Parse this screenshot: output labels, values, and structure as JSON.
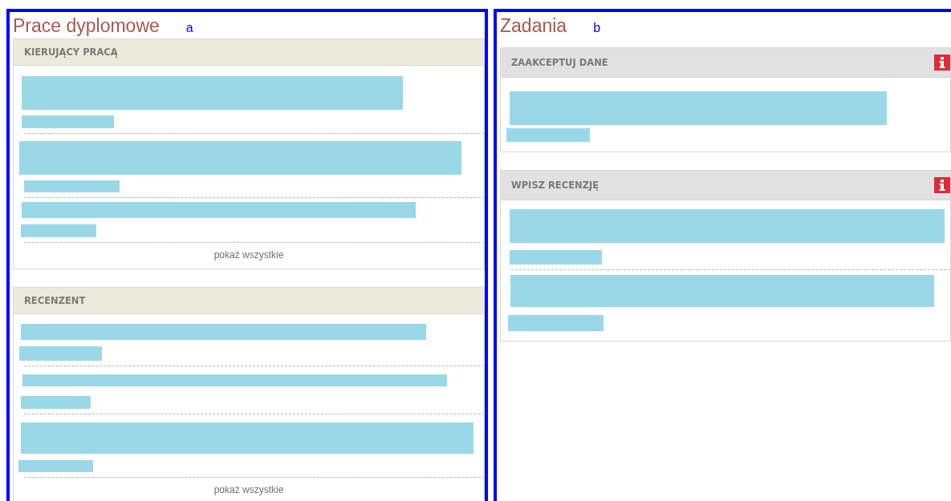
{
  "panels": [
    {
      "title": "Prace dyplomowe",
      "marker": "a",
      "sections": [
        {
          "heading": "KIERUJĄCY PRACĄ",
          "info": false,
          "items": [
            {
              "kind": "redacted"
            },
            {
              "kind": "redacted"
            },
            {
              "kind": "redacted"
            }
          ],
          "more_link": "pokaż wszystkie"
        },
        {
          "heading": "RECENZENT",
          "info": false,
          "items": [
            {
              "kind": "redacted"
            },
            {
              "kind": "redacted"
            },
            {
              "kind": "redacted"
            }
          ],
          "more_link": "pokaż wszystkie"
        }
      ]
    },
    {
      "title": "Zadania",
      "marker": "b",
      "sections": [
        {
          "heading": "ZAAKCEPTUJ DANE",
          "info": true,
          "items": [
            {
              "kind": "redacted"
            }
          ]
        },
        {
          "heading": "WPISZ RECENZJĘ",
          "info": true,
          "items": [
            {
              "kind": "redacted"
            },
            {
              "kind": "redacted"
            }
          ]
        }
      ]
    }
  ]
}
